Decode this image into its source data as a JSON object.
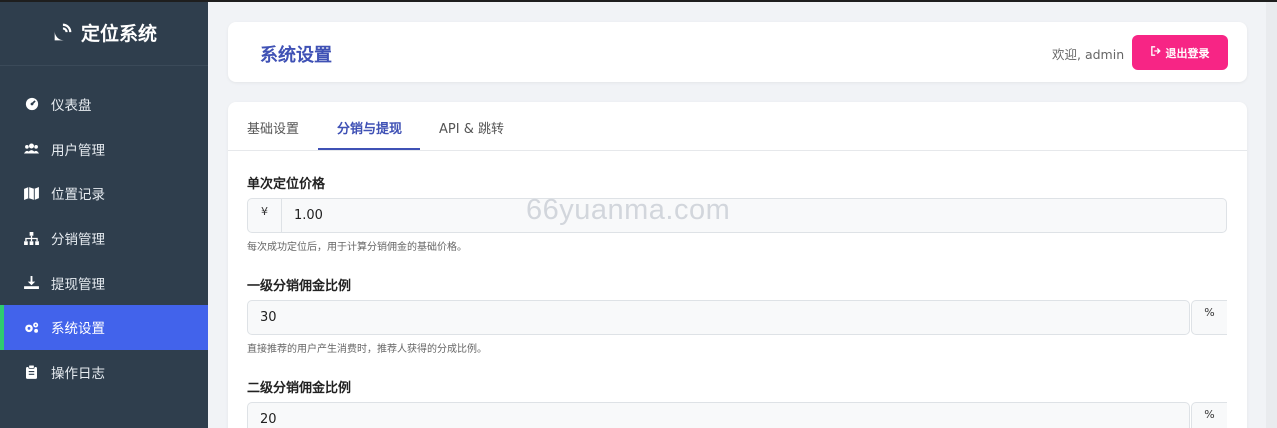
{
  "sidebar": {
    "brand": "定位系统",
    "brand_icon": "satellite-dish-icon",
    "items": [
      {
        "label": "仪表盘",
        "icon": "dashboard-icon",
        "active": false
      },
      {
        "label": "用户管理",
        "icon": "users-icon",
        "active": false
      },
      {
        "label": "位置记录",
        "icon": "map-icon",
        "active": false
      },
      {
        "label": "分销管理",
        "icon": "sitemap-icon",
        "active": false
      },
      {
        "label": "提现管理",
        "icon": "withdraw-icon",
        "active": false
      },
      {
        "label": "系统设置",
        "icon": "gears-icon",
        "active": true
      },
      {
        "label": "操作日志",
        "icon": "clipboard-icon",
        "active": false
      }
    ]
  },
  "header": {
    "title": "系统设置",
    "welcome": "欢迎, admin",
    "logout_label": "退出登录"
  },
  "tabs": [
    {
      "label": "基础设置",
      "active": false
    },
    {
      "label": "分销与提现",
      "active": true
    },
    {
      "label": "API & 跳转",
      "active": false
    }
  ],
  "form": {
    "price": {
      "label": "单次定位价格",
      "prefix": "¥",
      "value": "1.00",
      "help": "每次成功定位后，用于计算分销佣金的基础价格。"
    },
    "level1": {
      "label": "一级分销佣金比例",
      "value": "30",
      "suffix": "%",
      "help": "直接推荐的用户产生消费时，推荐人获得的分成比例。"
    },
    "level2": {
      "label": "二级分销佣金比例",
      "value": "20",
      "suffix": "%"
    }
  },
  "watermark": "66yuanma.com",
  "colors": {
    "sidebar_bg": "#2f3e4d",
    "active_bg": "#4263eb",
    "active_marker": "#2ecc71",
    "title": "#3f51b5",
    "logout": "#f72585"
  }
}
